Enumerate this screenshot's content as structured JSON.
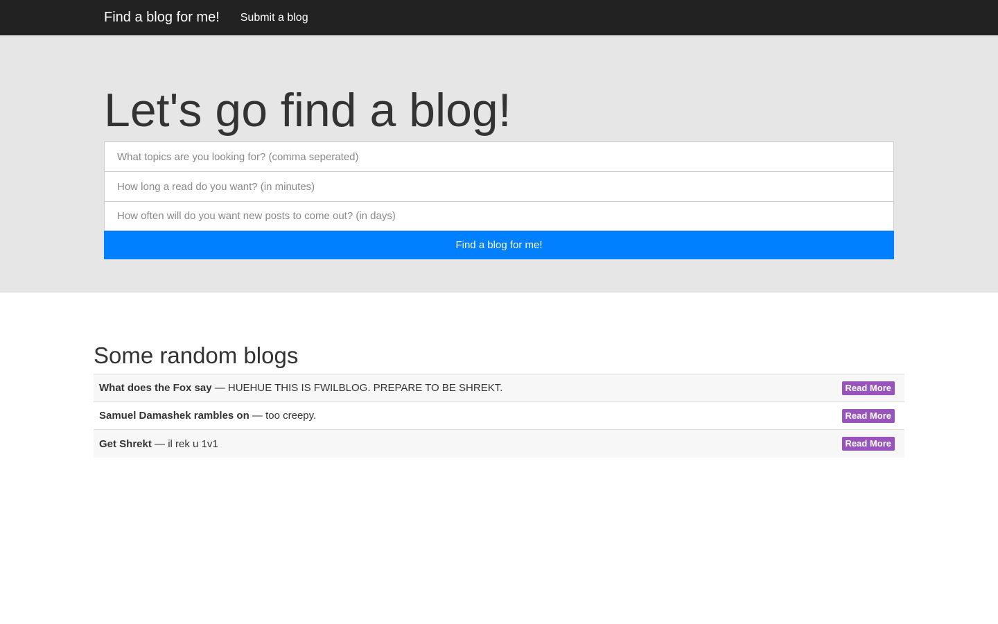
{
  "navbar": {
    "brand": "Find a blog for me!",
    "links": [
      {
        "label": "Submit a blog"
      }
    ]
  },
  "hero": {
    "title": "Let's go find a blog!",
    "form": {
      "topics_placeholder": "What topics are you looking for? (comma seperated)",
      "topics_value": "",
      "length_placeholder": "How long a read do you want? (in minutes)",
      "length_value": "",
      "frequency_placeholder": "How often will do you want new posts to come out? (in days)",
      "frequency_value": "",
      "submit_label": "Find a blog for me!"
    }
  },
  "random_blogs": {
    "title": "Some random blogs",
    "items": [
      {
        "name": "What does the Fox say",
        "separator": " — ",
        "description": "HUEHUE THIS IS FWILBLOG. PREPARE TO BE SHREKT.",
        "action": "Read More"
      },
      {
        "name": "Samuel Damashek rambles on",
        "separator": " — ",
        "description": "too creepy.",
        "action": "Read More"
      },
      {
        "name": "Get Shrekt",
        "separator": " — ",
        "description": "il rek u 1v1",
        "action": "Read More"
      }
    ]
  },
  "colors": {
    "navbar_bg": "#222222",
    "hero_bg": "#e6e6e6",
    "primary_button": "#007fff",
    "read_more_badge": "#9954bb"
  }
}
